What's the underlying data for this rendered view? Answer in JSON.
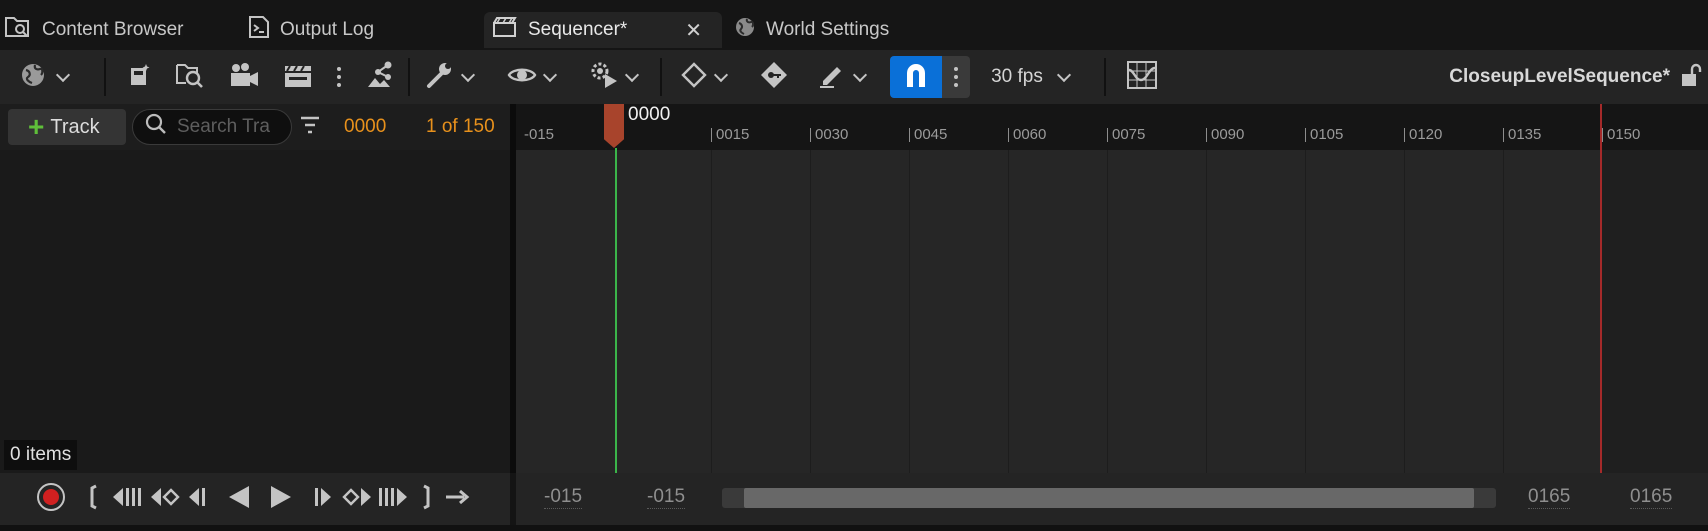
{
  "tabs": [
    {
      "label": "Content Browser",
      "icon": "content-browser-icon"
    },
    {
      "label": "Output Log",
      "icon": "output-log-icon"
    },
    {
      "label": "Sequencer*",
      "icon": "sequencer-icon",
      "active": true
    },
    {
      "label": "World Settings",
      "icon": "globe-icon"
    }
  ],
  "toolbar": {
    "fps_label": "30 fps",
    "sequence_name": "CloseupLevelSequence*",
    "accent_color": "#0a70d8"
  },
  "track_panel": {
    "add_track_label": "Track",
    "search_placeholder": "Search Tracks",
    "search_display": "Search Tra",
    "current_frame": "0000",
    "frame_count": "1 of 150",
    "frame_color": "#e8911c",
    "items_label": "0 items"
  },
  "timeline": {
    "ticks": [
      "-015",
      "0015",
      "0030",
      "0045",
      "0060",
      "0075",
      "0090",
      "0105",
      "0120",
      "0135",
      "0150"
    ],
    "playhead_label": "0000",
    "playhead_color": "#3bb54a",
    "end_color": "#a52a2a"
  },
  "range": {
    "view_start": "-015",
    "work_start": "-015",
    "work_end": "0165",
    "view_end": "0165"
  }
}
